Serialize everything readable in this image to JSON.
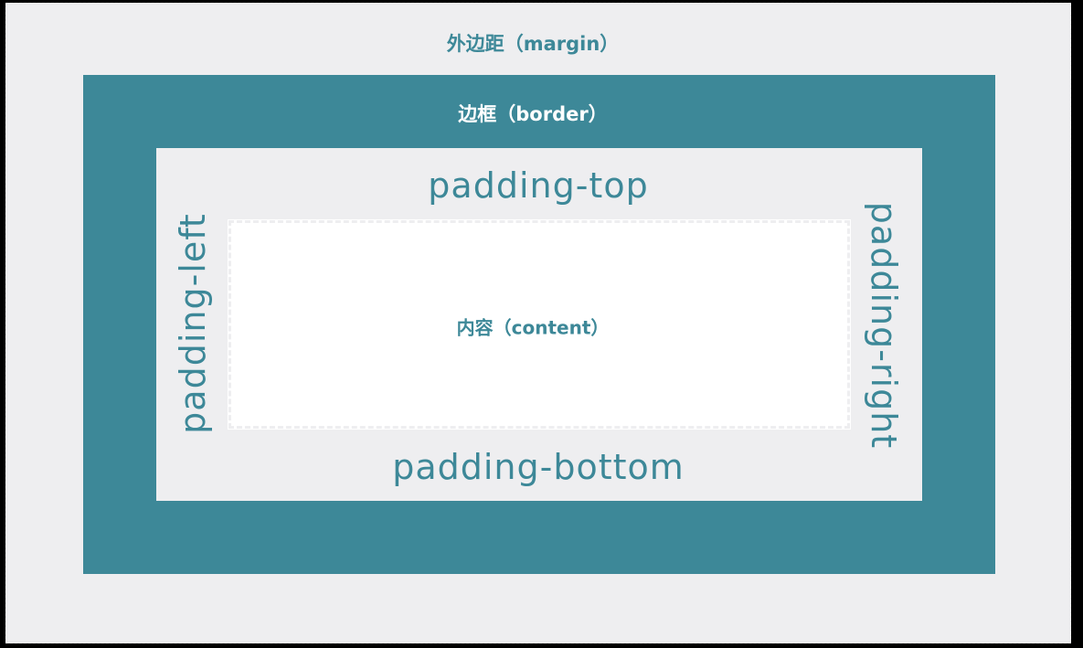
{
  "margin_label": "外边距（margin）",
  "border_label": "边框（border）",
  "padding_top": "padding-top",
  "padding_bottom": "padding-bottom",
  "padding_left": "padding-left",
  "padding_right": "padding-right",
  "content_label": "内容（content）",
  "colors": {
    "teal": "#3d8898",
    "light": "#eeeef0",
    "content": "#ffffff"
  }
}
